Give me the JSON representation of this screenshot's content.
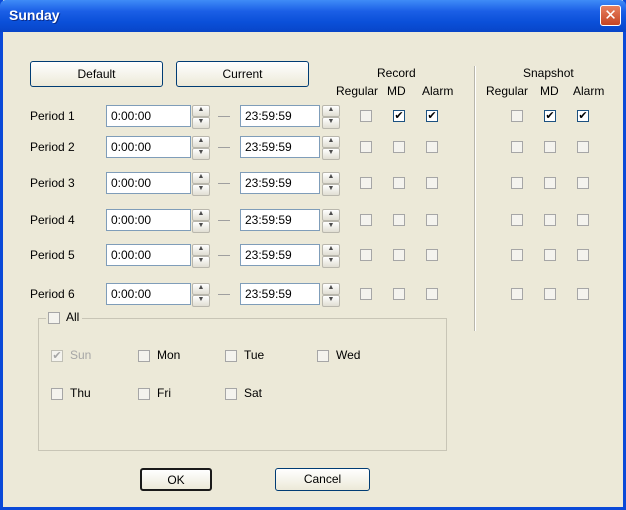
{
  "window": {
    "title": "Sunday",
    "close_symbol": "✕"
  },
  "buttons": {
    "default": "Default",
    "current": "Current",
    "ok": "OK",
    "cancel": "Cancel"
  },
  "headers": {
    "record": "Record",
    "snapshot": "Snapshot",
    "regular": "Regular",
    "md": "MD",
    "alarm": "Alarm"
  },
  "periods": [
    {
      "label": "Period 1",
      "start": "0:00:00",
      "end": "23:59:59",
      "record": {
        "regular": false,
        "md": true,
        "alarm": true
      },
      "snapshot": {
        "regular": false,
        "md": true,
        "alarm": true
      }
    },
    {
      "label": "Period 2",
      "start": "0:00:00",
      "end": "23:59:59",
      "record": {
        "regular": false,
        "md": false,
        "alarm": false
      },
      "snapshot": {
        "regular": false,
        "md": false,
        "alarm": false
      }
    },
    {
      "label": "Period 3",
      "start": "0:00:00",
      "end": "23:59:59",
      "record": {
        "regular": false,
        "md": false,
        "alarm": false
      },
      "snapshot": {
        "regular": false,
        "md": false,
        "alarm": false
      }
    },
    {
      "label": "Period 4",
      "start": "0:00:00",
      "end": "23:59:59",
      "record": {
        "regular": false,
        "md": false,
        "alarm": false
      },
      "snapshot": {
        "regular": false,
        "md": false,
        "alarm": false
      }
    },
    {
      "label": "Period 5",
      "start": "0:00:00",
      "end": "23:59:59",
      "record": {
        "regular": false,
        "md": false,
        "alarm": false
      },
      "snapshot": {
        "regular": false,
        "md": false,
        "alarm": false
      }
    },
    {
      "label": "Period 6",
      "start": "0:00:00",
      "end": "23:59:59",
      "record": {
        "regular": false,
        "md": false,
        "alarm": false
      },
      "snapshot": {
        "regular": false,
        "md": false,
        "alarm": false
      }
    }
  ],
  "days": {
    "all": {
      "label": "All",
      "checked": false
    },
    "items": [
      {
        "label": "Sun",
        "checked": true,
        "disabled": true
      },
      {
        "label": "Mon",
        "checked": false
      },
      {
        "label": "Tue",
        "checked": false
      },
      {
        "label": "Wed",
        "checked": false
      },
      {
        "label": "Thu",
        "checked": false
      },
      {
        "label": "Fri",
        "checked": false
      },
      {
        "label": "Sat",
        "checked": false
      }
    ]
  },
  "colors": {
    "titlebar": "#0a4fd8",
    "dialog_bg": "#ece9d8",
    "close_button": "#c54423"
  },
  "icons": {
    "spin": "spin-up-down-icon",
    "check": "✔"
  }
}
